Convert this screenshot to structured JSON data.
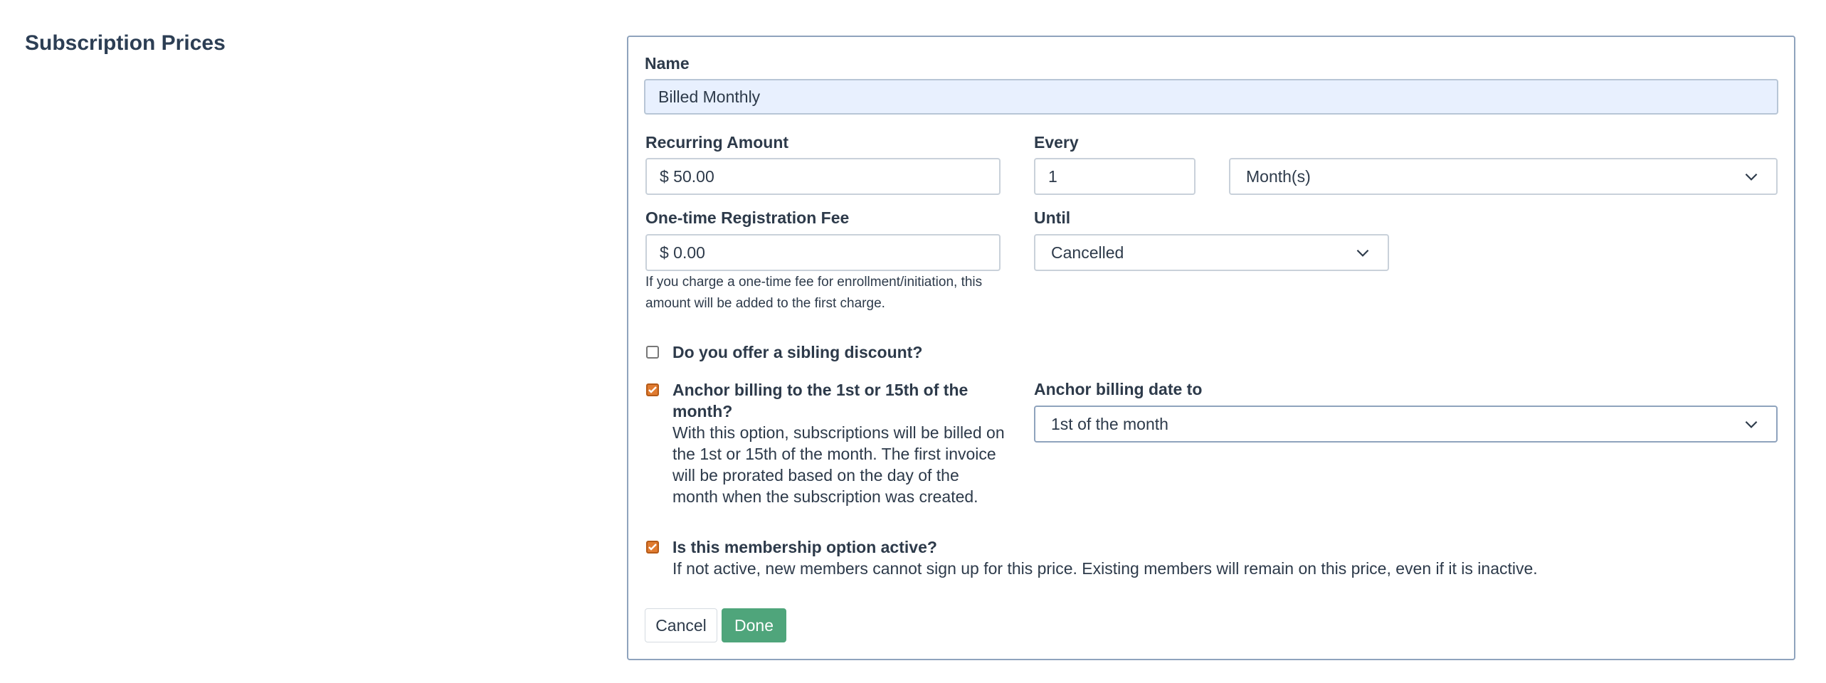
{
  "page": {
    "section_title": "Subscription Prices"
  },
  "form": {
    "name_label": "Name",
    "name_value": "Billed Monthly",
    "recurring_amount_label": "Recurring Amount",
    "recurring_amount_value": "$ 50.00",
    "every_label": "Every",
    "every_value": "1",
    "every_unit_selected": "Month(s)",
    "registration_fee_label": "One-time Registration Fee",
    "registration_fee_value": "$ 0.00",
    "registration_fee_help_line1": "If you charge a one-time fee for enrollment/initiation, this",
    "registration_fee_help_line2": "amount will be added to the first charge.",
    "until_label": "Until",
    "until_selected": "Cancelled",
    "sibling_discount_label": "Do you offer a sibling discount?",
    "sibling_discount_checked": false,
    "anchor_billing_title_line1": "Anchor billing to the 1st or 15th of the",
    "anchor_billing_title_line2": "month?",
    "anchor_billing_desc_line1": "With this option, subscriptions will be billed on",
    "anchor_billing_desc_line2": "the 1st or 15th of the month. The first invoice",
    "anchor_billing_desc_line3": "will be prorated based on the day of the",
    "anchor_billing_desc_line4": "month when the subscription was created.",
    "anchor_billing_checked": true,
    "anchor_date_label": "Anchor billing date to",
    "anchor_date_selected": "1st of the month",
    "active_label": "Is this membership option active?",
    "active_desc": "If not active, new members cannot sign up for this price. Existing members will remain on this price, even if it is inactive.",
    "active_checked": true
  },
  "actions": {
    "cancel_label": "Cancel",
    "done_label": "Done"
  },
  "colors": {
    "checkbox_checked": "#e07b30",
    "done_button": "#4fa57b",
    "name_field_bg": "#e8f0fe",
    "panel_border": "#8fa3bd"
  },
  "icons": {
    "select_arrow": "chevron-down-icon",
    "checkbox_check": "checkmark-icon"
  }
}
